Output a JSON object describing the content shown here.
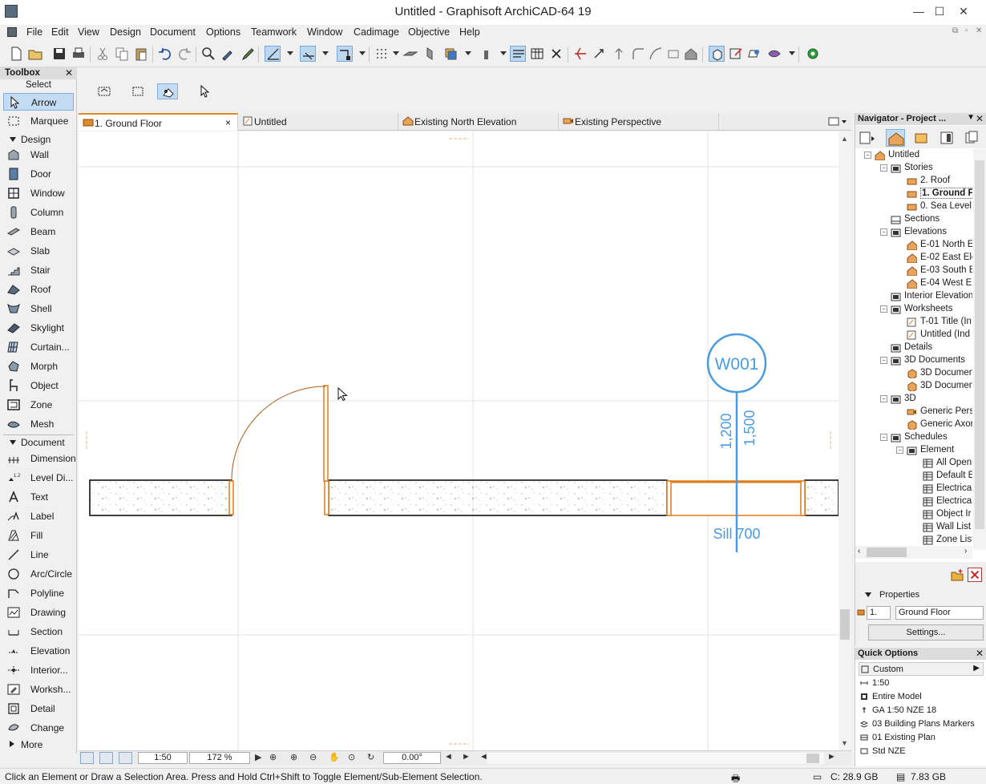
{
  "window": {
    "title": "Untitled - Graphisoft ArchiCAD-64 19",
    "minimize_icon": "minimize-icon",
    "maximize_icon": "maximize-icon",
    "close_icon": "close-icon"
  },
  "menu": [
    "File",
    "Edit",
    "View",
    "Design",
    "Document",
    "Options",
    "Teamwork",
    "Window",
    "Cadimage",
    "Objective",
    "Help"
  ],
  "toolbox": {
    "title": "Toolbox",
    "select_label": "Select",
    "select_tools": [
      "Arrow",
      "Marquee"
    ],
    "design_label": "Design",
    "design_tools": [
      "Wall",
      "Door",
      "Window",
      "Column",
      "Beam",
      "Slab",
      "Stair",
      "Roof",
      "Shell",
      "Skylight",
      "Curtain...",
      "Morph",
      "Object",
      "Zone",
      "Mesh"
    ],
    "document_label": "Document",
    "document_tools": [
      "Dimension",
      "Level Di...",
      "Text",
      "Label",
      "Fill",
      "Line",
      "Arc/Circle",
      "Polyline",
      "Drawing",
      "Section",
      "Elevation",
      "Interior...",
      "Worksh...",
      "Detail",
      "Change"
    ],
    "more_label": "More"
  },
  "tabs": [
    {
      "label": "1. Ground Floor",
      "active": true,
      "close": "×"
    },
    {
      "label": "Untitled",
      "active": false
    },
    {
      "label": "Existing North Elevation",
      "active": false
    },
    {
      "label": "Existing Perspective",
      "active": false
    }
  ],
  "canvas": {
    "window_marker": "W001",
    "dim_height": "1,200",
    "dim_width": "1,500",
    "sill": "Sill 700"
  },
  "bottombar": {
    "scale": "1:50",
    "zoom": "172 %",
    "angle": "0.00°"
  },
  "navigator": {
    "title": "Navigator - Project ...",
    "tree": [
      {
        "label": "Untitled",
        "level": 0,
        "icon": "project"
      },
      {
        "label": "Stories",
        "level": 1,
        "icon": "folder"
      },
      {
        "label": "2. Roof",
        "level": 2,
        "icon": "story"
      },
      {
        "label": "1. Ground F",
        "level": 2,
        "icon": "story",
        "selected": true
      },
      {
        "label": "0. Sea Level,",
        "level": 2,
        "icon": "story"
      },
      {
        "label": "Sections",
        "level": 1,
        "icon": "section"
      },
      {
        "label": "Elevations",
        "level": 1,
        "icon": "folder"
      },
      {
        "label": "E-01 North E",
        "level": 2,
        "icon": "elevation"
      },
      {
        "label": "E-02 East Ele",
        "level": 2,
        "icon": "elevation"
      },
      {
        "label": "E-03 South E",
        "level": 2,
        "icon": "elevation"
      },
      {
        "label": "E-04 West El",
        "level": 2,
        "icon": "elevation"
      },
      {
        "label": "Interior Elevation",
        "level": 1,
        "icon": "folder"
      },
      {
        "label": "Worksheets",
        "level": 1,
        "icon": "folder"
      },
      {
        "label": "T-01 Title (In",
        "level": 2,
        "icon": "worksheet"
      },
      {
        "label": "Untitled (Ind",
        "level": 2,
        "icon": "worksheet"
      },
      {
        "label": "Details",
        "level": 1,
        "icon": "folder"
      },
      {
        "label": "3D Documents",
        "level": 1,
        "icon": "folder"
      },
      {
        "label": "3D Documen",
        "level": 2,
        "icon": "doc3d"
      },
      {
        "label": "3D Documen",
        "level": 2,
        "icon": "doc3d"
      },
      {
        "label": "3D",
        "level": 1,
        "icon": "folder"
      },
      {
        "label": "Generic Pers",
        "level": 2,
        "icon": "camera"
      },
      {
        "label": "Generic Axor",
        "level": 2,
        "icon": "doc3d"
      },
      {
        "label": "Schedules",
        "level": 1,
        "icon": "folder"
      },
      {
        "label": "Element",
        "level": 2,
        "icon": "folder"
      },
      {
        "label": "All Openi",
        "level": 3,
        "icon": "schedule"
      },
      {
        "label": "Default E",
        "level": 3,
        "icon": "schedule"
      },
      {
        "label": "Electrical",
        "level": 3,
        "icon": "schedule"
      },
      {
        "label": "Electrical",
        "level": 3,
        "icon": "schedule"
      },
      {
        "label": "Object Ir",
        "level": 3,
        "icon": "schedule"
      },
      {
        "label": "Wall List",
        "level": 3,
        "icon": "schedule"
      },
      {
        "label": "Zone List",
        "level": 3,
        "icon": "schedule"
      }
    ]
  },
  "properties": {
    "label": "Properties",
    "number": "1.",
    "name": "Ground Floor",
    "settings_label": "Settings..."
  },
  "quick_options": {
    "title": "Quick Options",
    "rows": [
      "Custom",
      "1:50",
      "Entire Model",
      "GA 1:50 NZE 18",
      "03 Building Plans Markers",
      "01 Existing Plan",
      "Std NZE"
    ]
  },
  "status": {
    "message": "Click an Element or Draw a Selection Area. Press and Hold Ctrl+Shift to Toggle Element/Sub-Element Selection.",
    "disk": "C: 28.9 GB",
    "memory": "7.83 GB"
  },
  "colors": {
    "accent_orange": "#e07a1c",
    "marker_blue": "#4a9be0",
    "selection_blue": "#c4dcf3"
  }
}
